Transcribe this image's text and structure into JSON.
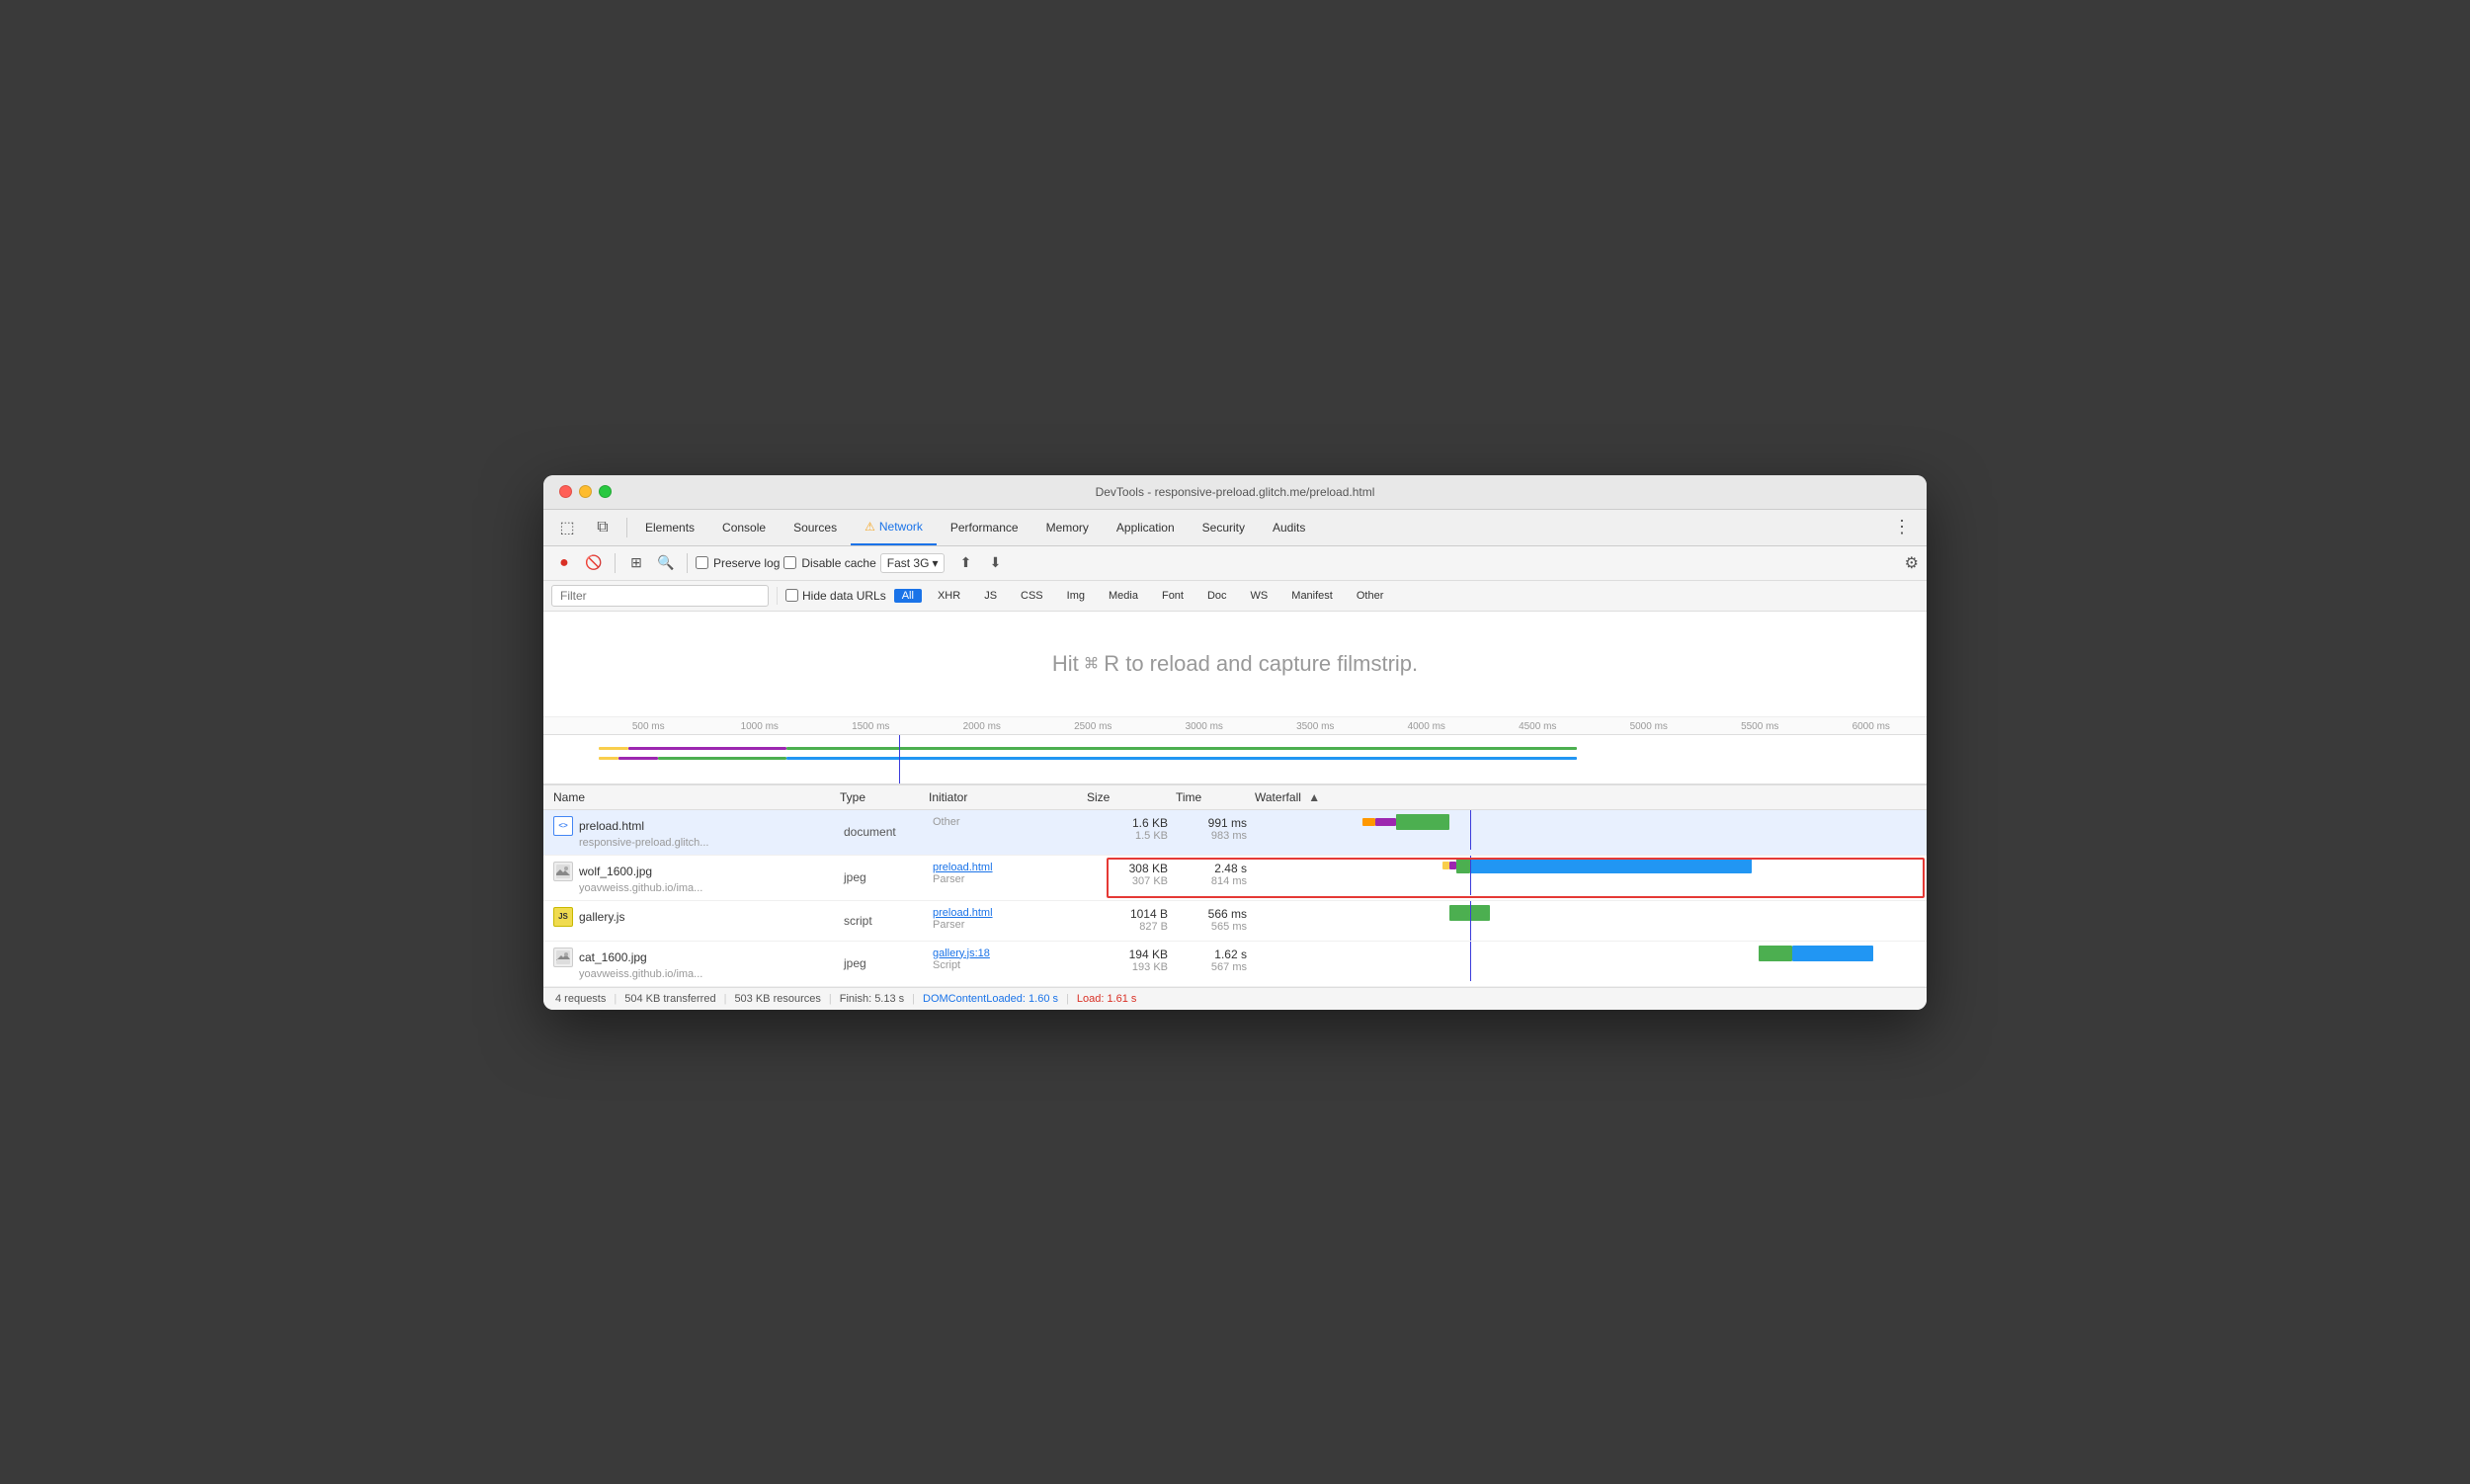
{
  "window": {
    "title": "DevTools - responsive-preload.glitch.me/preload.html"
  },
  "tabs": [
    {
      "id": "elements",
      "label": "Elements",
      "active": false
    },
    {
      "id": "console",
      "label": "Console",
      "active": false
    },
    {
      "id": "sources",
      "label": "Sources",
      "active": false
    },
    {
      "id": "network",
      "label": "Network",
      "active": true,
      "warn": true
    },
    {
      "id": "performance",
      "label": "Performance",
      "active": false
    },
    {
      "id": "memory",
      "label": "Memory",
      "active": false
    },
    {
      "id": "application",
      "label": "Application",
      "active": false
    },
    {
      "id": "security",
      "label": "Security",
      "active": false
    },
    {
      "id": "audits",
      "label": "Audits",
      "active": false
    }
  ],
  "toolbar": {
    "preserve_log": "Preserve log",
    "disable_cache": "Disable cache",
    "throttle": "Fast 3G"
  },
  "filter": {
    "placeholder": "Filter",
    "hide_data_urls": "Hide data URLs",
    "types": [
      "All",
      "XHR",
      "JS",
      "CSS",
      "Img",
      "Media",
      "Font",
      "Doc",
      "WS",
      "Manifest",
      "Other"
    ]
  },
  "filmstrip": {
    "message": "Hit ⌘ R to reload and capture filmstrip."
  },
  "ruler": {
    "ticks": [
      "500 ms",
      "1000 ms",
      "1500 ms",
      "2000 ms",
      "2500 ms",
      "3000 ms",
      "3500 ms",
      "4000 ms",
      "4500 ms",
      "5000 ms",
      "5500 ms",
      "6000 ms"
    ]
  },
  "table": {
    "columns": {
      "name": "Name",
      "type": "Type",
      "initiator": "Initiator",
      "size": "Size",
      "time": "Time",
      "waterfall": "Waterfall"
    },
    "rows": [
      {
        "name": "preload.html",
        "url": "responsive-preload.glitch...",
        "type": "document",
        "initiator_link": "",
        "initiator_label": "Other",
        "initiator_sub": "",
        "size1": "1.6 KB",
        "size2": "1.5 KB",
        "time1": "991 ms",
        "time2": "983 ms",
        "selected": true,
        "icon_type": "html"
      },
      {
        "name": "wolf_1600.jpg",
        "url": "yoavweiss.github.io/ima...",
        "type": "jpeg",
        "initiator_link": "preload.html",
        "initiator_label": "",
        "initiator_sub": "Parser",
        "size1": "308 KB",
        "size2": "307 KB",
        "time1": "2.48 s",
        "time2": "814 ms",
        "selected": false,
        "icon_type": "jpg"
      },
      {
        "name": "gallery.js",
        "url": "",
        "type": "script",
        "initiator_link": "preload.html",
        "initiator_label": "",
        "initiator_sub": "Parser",
        "size1": "1014 B",
        "size2": "827 B",
        "time1": "566 ms",
        "time2": "565 ms",
        "selected": false,
        "icon_type": "js"
      },
      {
        "name": "cat_1600.jpg",
        "url": "yoavweiss.github.io/ima...",
        "type": "jpeg",
        "initiator_link": "gallery.js:18",
        "initiator_label": "",
        "initiator_sub": "Script",
        "size1": "194 KB",
        "size2": "193 KB",
        "time1": "1.62 s",
        "time2": "567 ms",
        "selected": false,
        "icon_type": "jpg"
      }
    ]
  },
  "status_bar": {
    "requests": "4 requests",
    "transferred": "504 KB transferred",
    "resources": "503 KB resources",
    "finish": "Finish: 5.13 s",
    "dom_content": "DOMContentLoaded: 1.60 s",
    "load": "Load: 1.61 s"
  }
}
